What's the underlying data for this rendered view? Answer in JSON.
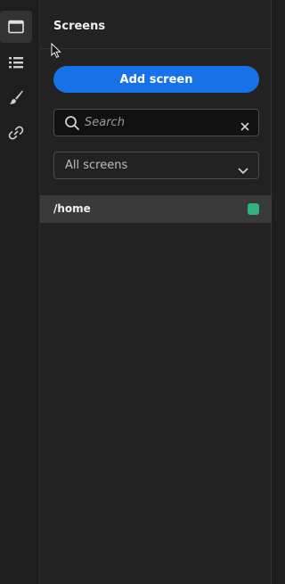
{
  "rail": {
    "items": [
      {
        "name": "screens",
        "icon": "window-icon",
        "active": true
      },
      {
        "name": "list",
        "icon": "list-icon",
        "active": false
      },
      {
        "name": "style",
        "icon": "brush-icon",
        "active": false
      },
      {
        "name": "links",
        "icon": "link-icon",
        "active": false
      }
    ]
  },
  "panel": {
    "title": "Screens",
    "add_button_label": "Add screen",
    "search": {
      "placeholder": "Search",
      "value": ""
    },
    "filter": {
      "selected": "All screens"
    },
    "screens": [
      {
        "label": "/home",
        "status_color": "#2fb37f"
      }
    ]
  },
  "colors": {
    "accent": "#1672e6",
    "status_ok": "#2fb37f"
  }
}
